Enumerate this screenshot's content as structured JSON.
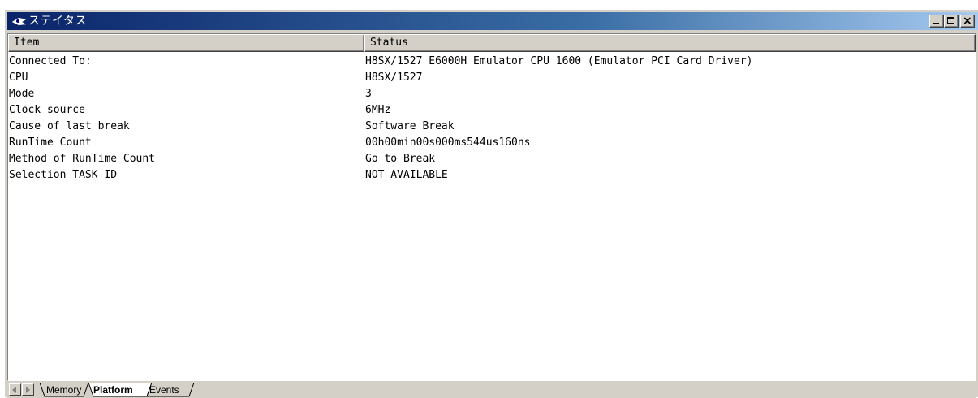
{
  "window": {
    "title": "ステイタス",
    "controls": {
      "minimize": "minimize",
      "maximize": "maximize",
      "close": "close"
    }
  },
  "table": {
    "columns": [
      "Item",
      "Status"
    ],
    "rows": [
      {
        "item": "Connected To:",
        "status": "H8SX/1527 E6000H Emulator CPU 1600 (Emulator PCI Card Driver)"
      },
      {
        "item": "CPU",
        "status": "H8SX/1527"
      },
      {
        "item": "Mode",
        "status": "3"
      },
      {
        "item": "Clock source",
        "status": "6MHz"
      },
      {
        "item": "Cause of last break",
        "status": "Software Break"
      },
      {
        "item": "RunTime Count",
        "status": "00h00min00s000ms544us160ns"
      },
      {
        "item": "Method of RunTime Count",
        "status": "Go to Break"
      },
      {
        "item": "Selection TASK ID",
        "status": "NOT AVAILABLE"
      }
    ]
  },
  "tabs": [
    {
      "label": "Memory",
      "active": false
    },
    {
      "label": "Platform",
      "active": true
    },
    {
      "label": "Events",
      "active": false
    }
  ],
  "icons": {
    "title_icon": "status-app-icon",
    "scroll_left": "scroll-left-arrow-icon",
    "scroll_right": "scroll-right-arrow-icon"
  },
  "colors": {
    "titlebar_start": "#0a246a",
    "titlebar_end": "#a6caf0",
    "chrome": "#d4d0c8"
  }
}
